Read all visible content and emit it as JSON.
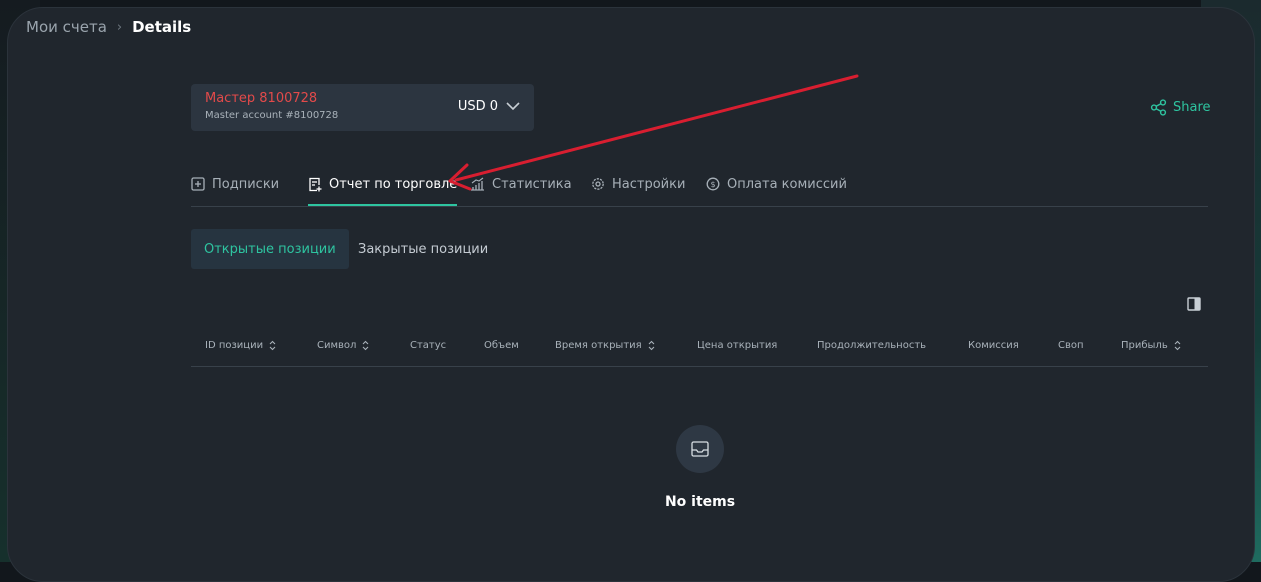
{
  "breadcrumb": {
    "parent": "Мои счета",
    "separator": "›",
    "current": "Details"
  },
  "account": {
    "name": "Мастер 8100728",
    "subtitle": "Master account #8100728",
    "balance": "USD 0"
  },
  "share": {
    "label": "Share"
  },
  "tabs": [
    {
      "label": "Подписки",
      "icon": "plus-square-icon"
    },
    {
      "label": "Отчет по торговле",
      "icon": "report-icon",
      "active": true
    },
    {
      "label": "Статистика",
      "icon": "chart-icon"
    },
    {
      "label": "Настройки",
      "icon": "gear-icon"
    },
    {
      "label": "Оплата комиссий",
      "icon": "dollar-circle-icon"
    }
  ],
  "subtabs": [
    {
      "label": "Открытые позиции",
      "active": true
    },
    {
      "label": "Закрытые позиции"
    }
  ],
  "table": {
    "columns": [
      {
        "label": "ID позиции",
        "sortable": true
      },
      {
        "label": "Символ",
        "sortable": true
      },
      {
        "label": "Статус"
      },
      {
        "label": "Объем"
      },
      {
        "label": "Время открытия",
        "sortable": true
      },
      {
        "label": "Цена открытия"
      },
      {
        "label": "Продолжительность"
      },
      {
        "label": "Комиссия"
      },
      {
        "label": "Своп"
      },
      {
        "label": "Прибыль",
        "sortable": true
      }
    ],
    "empty_text": "No items"
  },
  "colors": {
    "accent": "#2ec4a0",
    "account_name": "#e34a4a",
    "annotation_arrow": "#d81e30"
  }
}
